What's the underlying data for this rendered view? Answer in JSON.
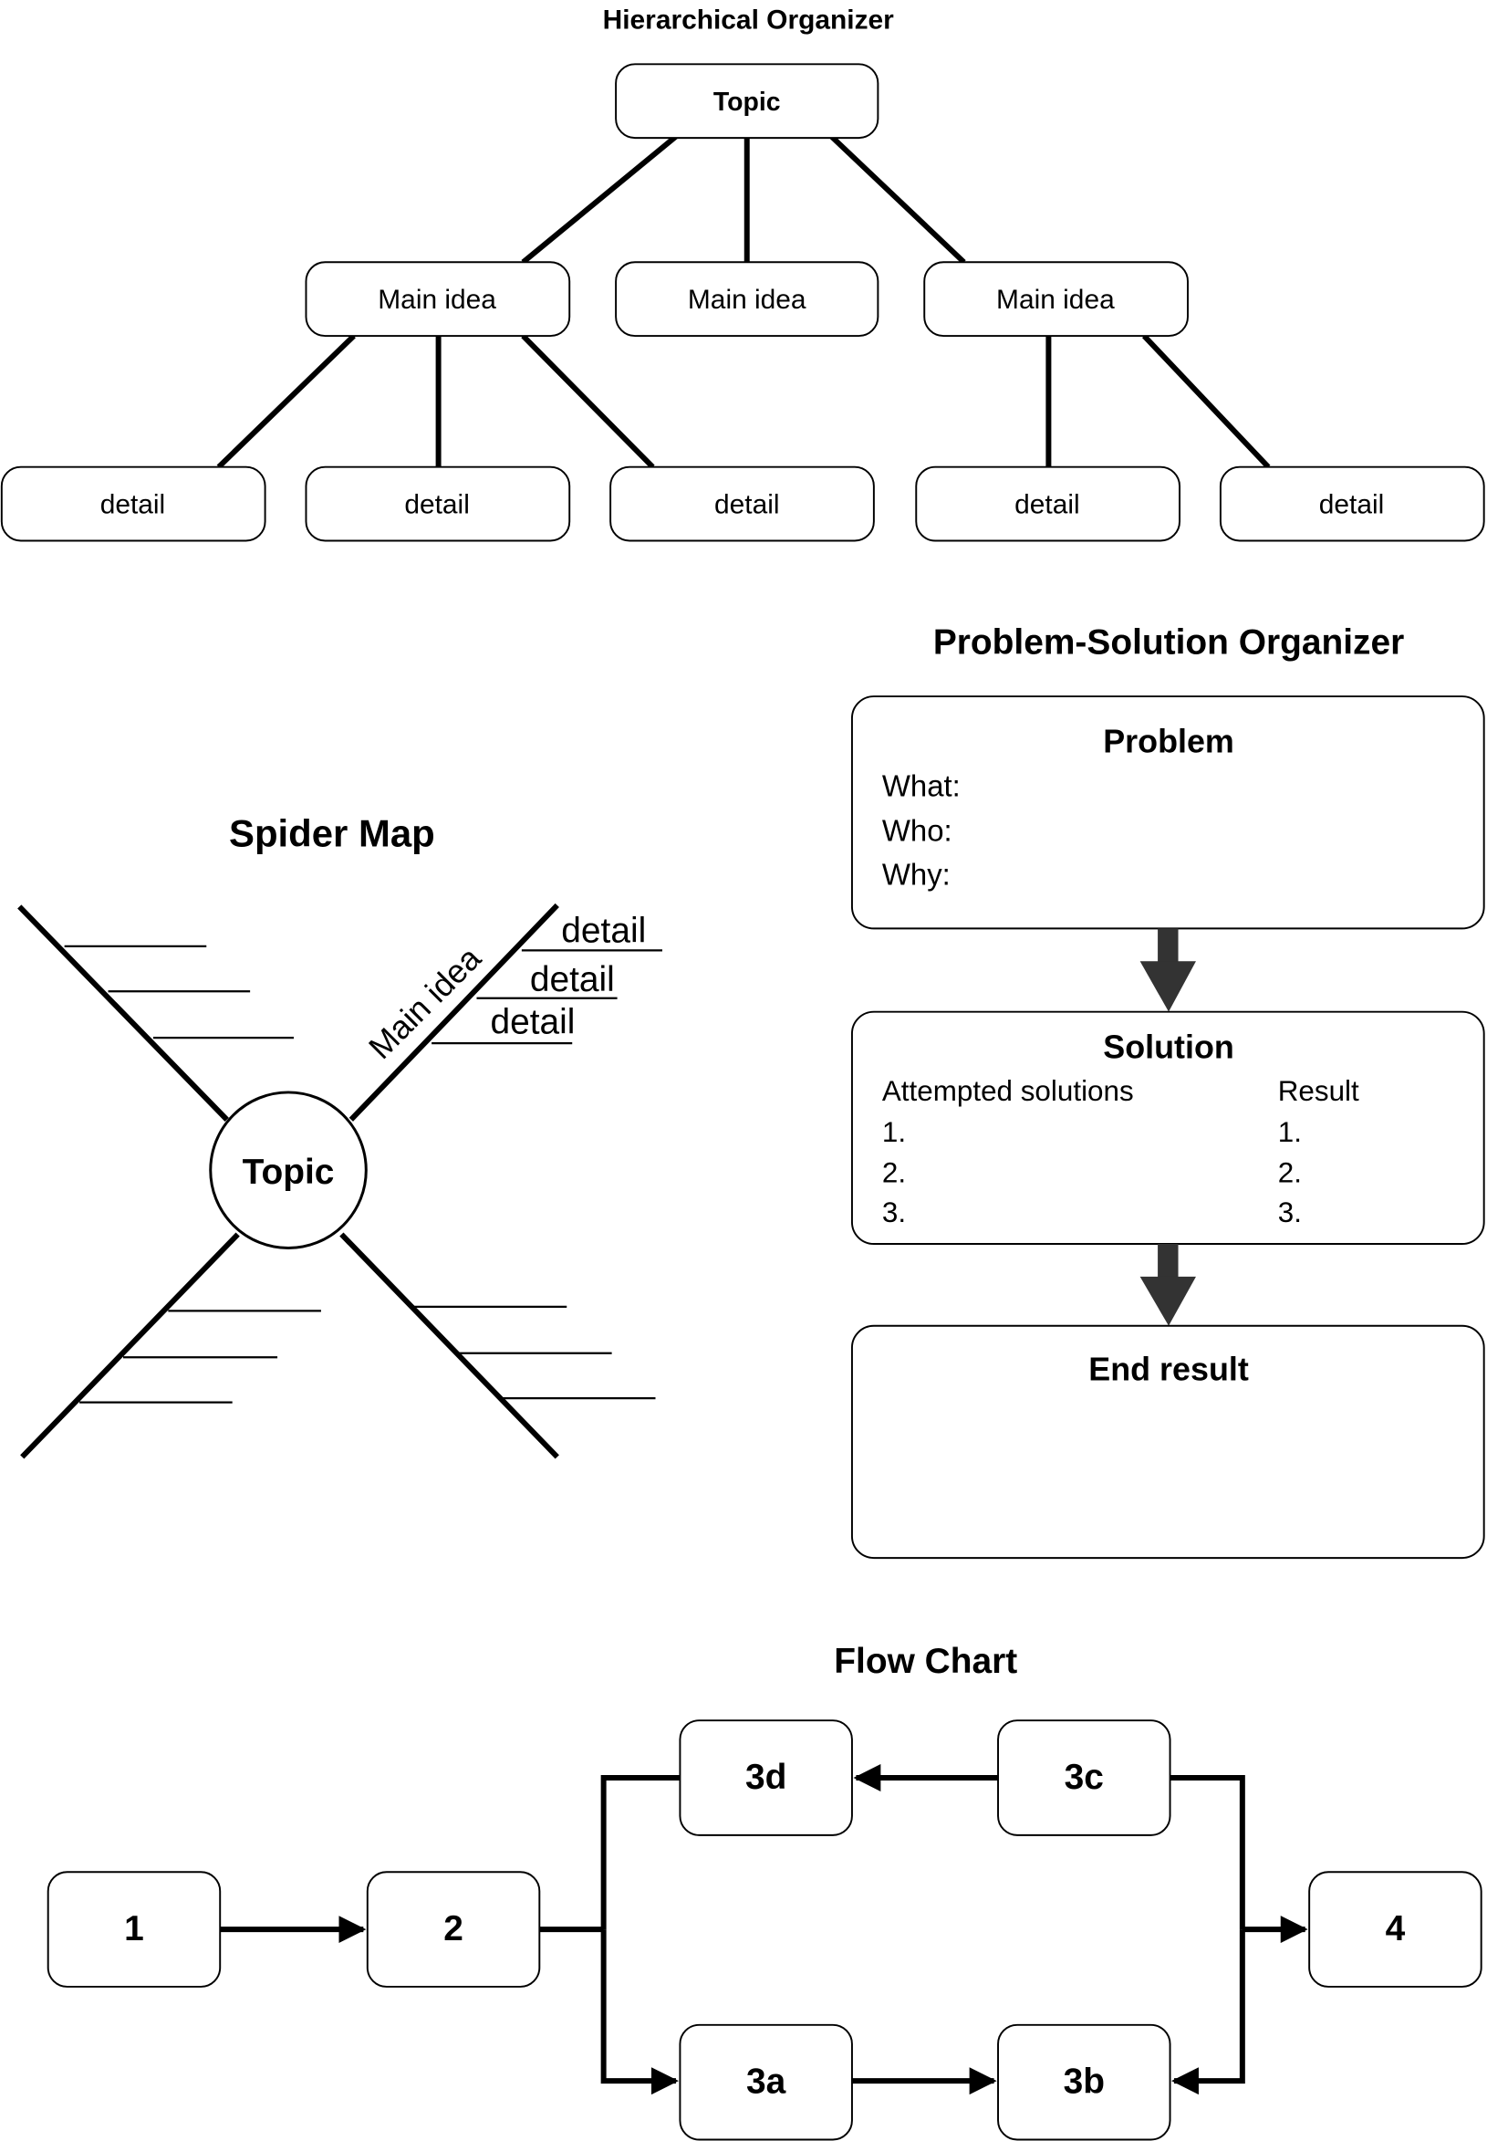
{
  "hierarchical": {
    "title": "Hierarchical Organizer",
    "topic": "Topic",
    "main_ideas": [
      "Main idea",
      "Main idea",
      "Main idea"
    ],
    "details": [
      "detail",
      "detail",
      "detail",
      "detail",
      "detail"
    ]
  },
  "problem_solution": {
    "title": "Problem-Solution Organizer",
    "problem": {
      "heading": "Problem",
      "lines": [
        "What:",
        "Who:",
        "Why:"
      ]
    },
    "solution": {
      "heading": "Solution",
      "left_header": "Attempted solutions",
      "right_header": "Result",
      "left_items": [
        "1.",
        "2.",
        "3."
      ],
      "right_items": [
        "1.",
        "2.",
        "3."
      ]
    },
    "end_result": {
      "heading": "End result"
    },
    "arrow_color": "#333333"
  },
  "spider_map": {
    "title": "Spider Map",
    "topic": "Topic",
    "main_idea": "Main idea",
    "details": [
      "detail",
      "detail",
      "detail"
    ]
  },
  "flow_chart": {
    "title": "Flow Chart",
    "steps": {
      "s1": "1",
      "s2": "2",
      "s3a": "3a",
      "s3b": "3b",
      "s3c": "3c",
      "s3d": "3d",
      "s4": "4"
    }
  }
}
